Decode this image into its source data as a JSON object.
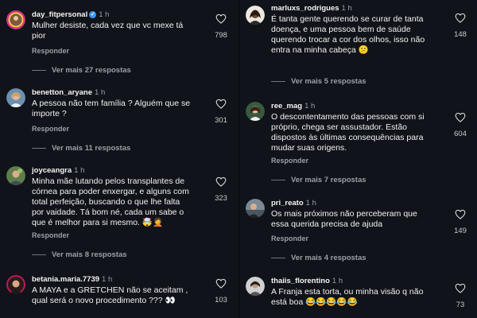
{
  "left": {
    "comments": [
      {
        "username": "day_fitpersonal",
        "verified": true,
        "time": "1 h",
        "text": "Mulher desiste, cada vez que vc mexe tá\npior",
        "likes": "798",
        "reply": "Responder",
        "more": "Ver mais 27 respostas"
      },
      {
        "username": "benetton_aryane",
        "verified": false,
        "time": "1 h",
        "text": "A pessoa não tem família ? Alguém que se\nimporte ?",
        "likes": "301",
        "reply": "Responder",
        "more": "Ver mais 11 respostas"
      },
      {
        "username": "joyceangra",
        "verified": false,
        "time": "1 h",
        "text": "Minha mãe lutando pelos transplantes de\ncórnea para poder enxergar, e alguns com\ntotal perfeição, buscando o que lhe falta\npor vaidade.  Tá bom né, cada um sabe o\nque é melhor para si mesmo. 🤯🤦",
        "likes": "323",
        "reply": "Responder",
        "more": "Ver mais 8 respostas"
      },
      {
        "username": "betania.maria.7739",
        "verified": false,
        "time": "1 h",
        "text": "A MAYA e a GRETCHEN  não se aceitam ,\nqual será o novo procedimento ??? 👀",
        "likes": "103",
        "reply": "",
        "more": ""
      }
    ]
  },
  "right": {
    "comments": [
      {
        "username": "marluxs_rodrigues",
        "verified": false,
        "time": "1 h",
        "text": "É tanta gente querendo se curar de tanta\ndoença, e uma pessoa bem de saúde\nquerendo trocar a cor dos olhos, isso não\nentra na minha cabeça 😕",
        "likes": "148",
        "reply": "",
        "more": "Ver mais 5 respostas"
      },
      {
        "username": "ree_mag",
        "verified": false,
        "time": "1 h",
        "text": "O descontentamento das pessoas com si\npróprio, chega ser assustador.  Estão\ndispostos às últimas consequências para\nmudar suas origens.",
        "likes": "604",
        "reply": "Responder",
        "more": "Ver mais 7 respostas"
      },
      {
        "username": "pri_reato",
        "verified": false,
        "time": "1 h",
        "text": "Os mais próximos não perceberam que\nessa querida precisa de ajuda",
        "likes": "149",
        "reply": "Responder",
        "more": "Ver mais 4 respostas"
      },
      {
        "username": "thaiis_florentino",
        "verified": false,
        "time": "1 h",
        "text": "A Franja esta torta,  ou minha visão q não\nestá boa 😂😂😂😂😂",
        "likes": "73",
        "reply": "",
        "more": ""
      }
    ]
  },
  "colors": {
    "background": "#101319",
    "text": "#f2f2f2",
    "muted": "#9aa0a6",
    "verified": "#3897f0"
  }
}
